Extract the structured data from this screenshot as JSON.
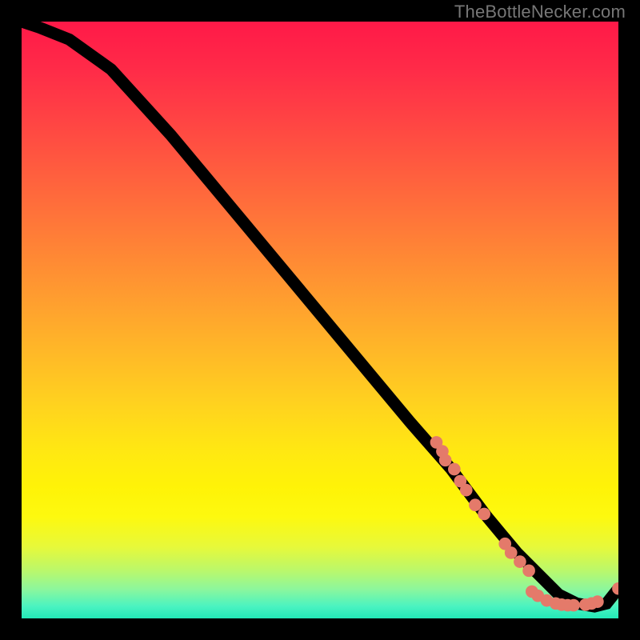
{
  "watermark": "TheBottleNecker.com",
  "chart_data": {
    "type": "line",
    "title": "",
    "xlabel": "",
    "ylabel": "",
    "xlim": [
      0,
      100
    ],
    "ylim": [
      0,
      100
    ],
    "series": [
      {
        "name": "curve",
        "x": [
          0,
          3,
          8,
          15,
          25,
          35,
          45,
          55,
          65,
          72,
          78,
          83,
          87,
          90,
          93,
          96,
          98,
          100
        ],
        "y": [
          100,
          99,
          97,
          92,
          81,
          69,
          57,
          45,
          33,
          25,
          17,
          11,
          7,
          4,
          2.5,
          2,
          2.5,
          5
        ]
      }
    ],
    "scatter_clusters": [
      {
        "name": "upper-dots",
        "points": [
          {
            "x": 69.5,
            "y": 29.5
          },
          {
            "x": 70.5,
            "y": 28.0
          },
          {
            "x": 71.0,
            "y": 26.5
          },
          {
            "x": 72.5,
            "y": 25.0
          },
          {
            "x": 73.5,
            "y": 23.0
          },
          {
            "x": 74.5,
            "y": 21.5
          },
          {
            "x": 76.0,
            "y": 19.0
          },
          {
            "x": 77.5,
            "y": 17.5
          }
        ]
      },
      {
        "name": "mid-dots",
        "points": [
          {
            "x": 81.0,
            "y": 12.5
          },
          {
            "x": 82.0,
            "y": 11.0
          },
          {
            "x": 83.5,
            "y": 9.5
          },
          {
            "x": 85.0,
            "y": 8.0
          }
        ]
      },
      {
        "name": "bottom-dots",
        "points": [
          {
            "x": 85.5,
            "y": 4.5
          },
          {
            "x": 86.5,
            "y": 3.8
          },
          {
            "x": 88.0,
            "y": 3.0
          },
          {
            "x": 89.5,
            "y": 2.5
          },
          {
            "x": 90.5,
            "y": 2.3
          },
          {
            "x": 91.5,
            "y": 2.2
          },
          {
            "x": 92.5,
            "y": 2.2
          },
          {
            "x": 94.5,
            "y": 2.3
          },
          {
            "x": 95.5,
            "y": 2.5
          },
          {
            "x": 96.5,
            "y": 2.8
          },
          {
            "x": 100.0,
            "y": 5.0
          }
        ]
      }
    ],
    "colors": {
      "dot": "#e47a6a",
      "curve": "#000000"
    }
  }
}
